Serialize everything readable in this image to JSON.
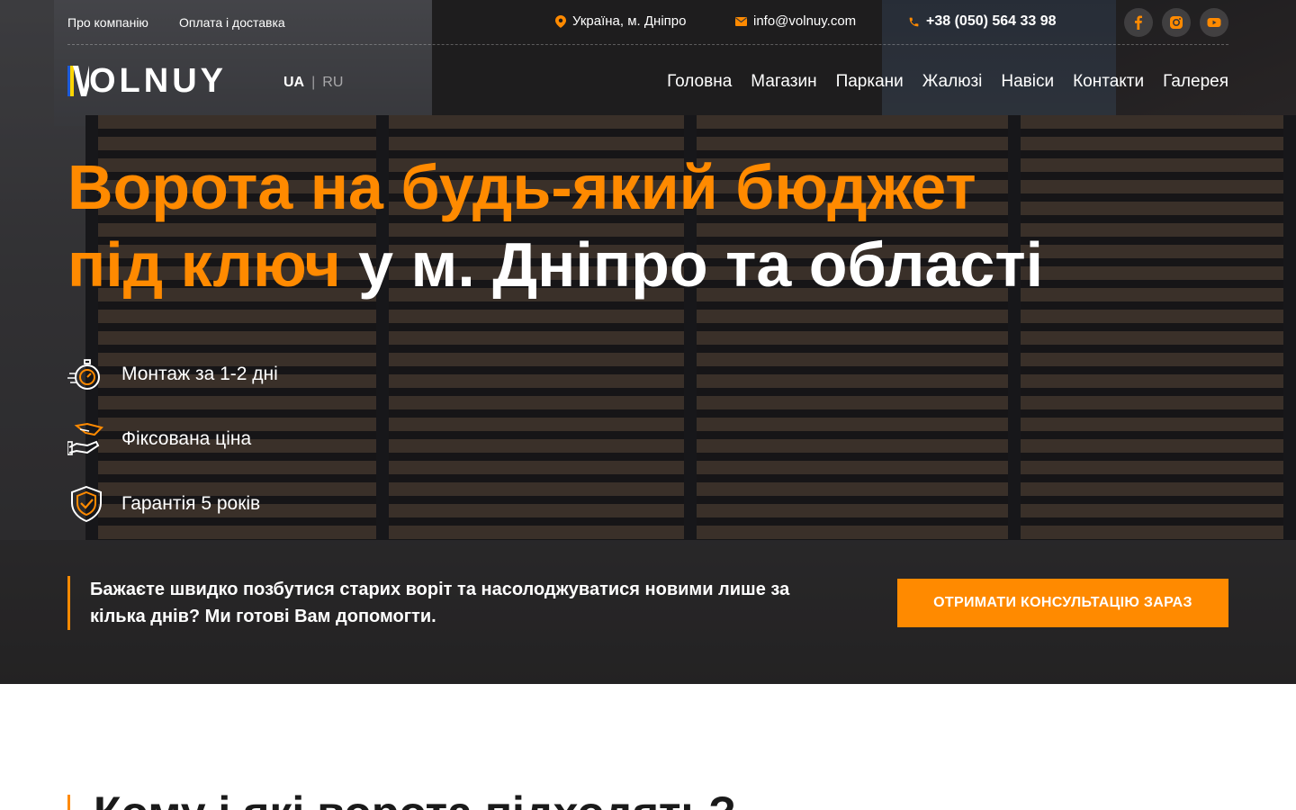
{
  "topbar": {
    "links": [
      "Про компанію",
      "Оплата і доставка"
    ],
    "location": "Україна, м. Дніпро",
    "email": "info@volnuy.com",
    "phone": "+38 (050) 564 33 98",
    "social": [
      "facebook-icon",
      "instagram-icon",
      "youtube-icon"
    ]
  },
  "header": {
    "logo": "VOLNUY",
    "lang_active": "UA",
    "lang_separator": "|",
    "lang_inactive": "RU",
    "nav": [
      "Головна",
      "Магазин",
      "Паркани",
      "Жалюзі",
      "Навіси",
      "Контакти",
      "Галерея"
    ]
  },
  "hero": {
    "title_line1": "Ворота на будь-який бюджет",
    "title_line2_orange": "під ключ",
    "title_line2_white": " у м. Дніпро та області",
    "features": [
      {
        "icon": "stopwatch-icon",
        "text": "Монтаж за 1-2 дні"
      },
      {
        "icon": "handshake-icon",
        "text": "Фіксована ціна"
      },
      {
        "icon": "shield-check-icon",
        "text": "Гарантія 5 років"
      }
    ],
    "cta_text": "Бажаєте швидко позбутися старих воріт та насолоджуватися новими лише за кілька днів? Ми готові Вам допомогти.",
    "cta_button": "ОТРИМАТИ КОНСУЛЬТАЦІЮ ЗАРАЗ"
  },
  "next_section": {
    "heading_partial": "Кому і які ворота підходять?"
  },
  "colors": {
    "accent": "#ff8a00",
    "logo_blue": "#1d5bd8",
    "logo_yellow": "#ffd500"
  }
}
